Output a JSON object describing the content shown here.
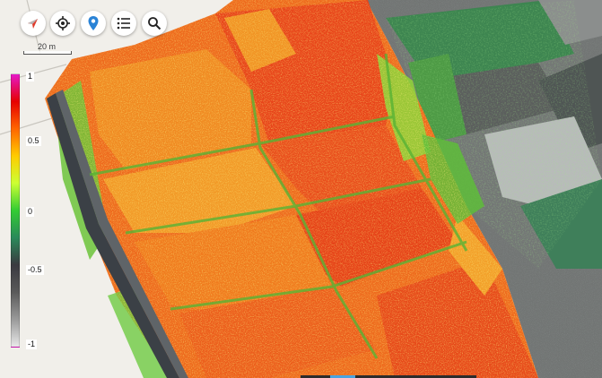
{
  "toolbar": {
    "buttons": [
      {
        "icon": "compass-icon",
        "name": "compass-button"
      },
      {
        "icon": "crosshair-icon",
        "name": "my-location-button"
      },
      {
        "icon": "map-pin-icon",
        "name": "place-pin-button"
      },
      {
        "icon": "layers-list-icon",
        "name": "layers-list-button"
      },
      {
        "icon": "search-icon",
        "name": "search-button"
      }
    ]
  },
  "scale": {
    "label": "20 m"
  },
  "legend": {
    "labels": [
      "1",
      "0.5",
      "0",
      "-0.5",
      "-1"
    ],
    "colors": [
      "#e619c8",
      "#e60000",
      "#ff6600",
      "#ffcc00",
      "#ccff33",
      "#33cc33",
      "#2a8a5a",
      "#3a3a40",
      "#5a5a5a",
      "#9a9a9a",
      "#e8e8e8"
    ]
  },
  "colors": {
    "background": "#f1efea",
    "field_red": "#e8431a",
    "field_orange": "#f07a1e",
    "field_yellow": "#f5b52a",
    "vegetation_green": "#4cbf3a",
    "dark_green": "#3f7d4d",
    "bare_gray": "#7a7d7c"
  }
}
